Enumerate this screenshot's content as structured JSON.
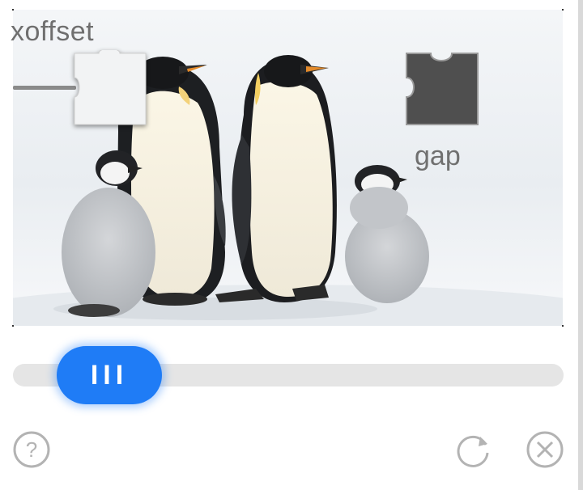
{
  "captcha": {
    "labels": {
      "xoffset": "xoffset",
      "gap": "gap"
    },
    "image_description_icon": "penguins-photo",
    "colors": {
      "accent": "#1f7cf6",
      "track": "#e5e5e5",
      "gap_fill": "#4f4f4f",
      "icon": "#b3b3b3"
    }
  },
  "slider": {
    "handle_glyph": "III",
    "value": 0.08
  },
  "footer": {
    "help_icon": "help-icon",
    "refresh_icon": "refresh-icon",
    "close_icon": "close-icon"
  }
}
